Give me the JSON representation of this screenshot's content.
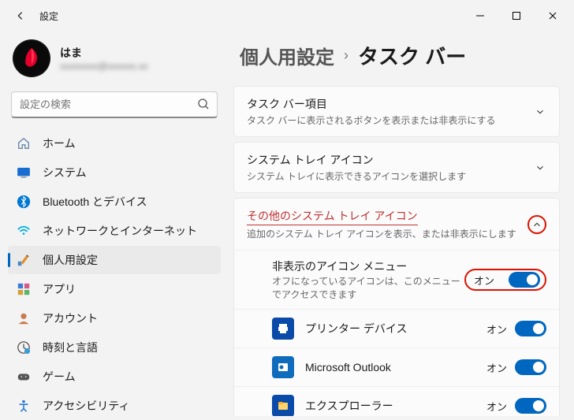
{
  "titlebar": {
    "title": "設定"
  },
  "user": {
    "name": "はま",
    "email": "xxxxxxxx@xxxxxx.xx"
  },
  "search": {
    "placeholder": "設定の検索"
  },
  "nav": {
    "items": [
      {
        "label": "ホーム"
      },
      {
        "label": "システム"
      },
      {
        "label": "Bluetooth とデバイス"
      },
      {
        "label": "ネットワークとインターネット"
      },
      {
        "label": "個人用設定"
      },
      {
        "label": "アプリ"
      },
      {
        "label": "アカウント"
      },
      {
        "label": "時刻と言語"
      },
      {
        "label": "ゲーム"
      },
      {
        "label": "アクセシビリティ"
      }
    ]
  },
  "breadcrumb": {
    "parent": "個人用設定",
    "sep": "›",
    "current": "タスク バー"
  },
  "sections": {
    "items": {
      "title": "タスク バー項目",
      "desc": "タスク バーに表示されるボタンを表示または非表示にする"
    },
    "tray": {
      "title": "システム トレイ アイコン",
      "desc": "システム トレイに表示できるアイコンを選択します"
    },
    "other": {
      "title": "その他のシステム トレイ アイコン",
      "desc": "追加のシステム トレイ アイコンを表示、または非表示にします"
    }
  },
  "rows": {
    "hiddenMenu": {
      "title": "非表示のアイコン メニュー",
      "desc": "オフになっているアイコンは、このメニューでアクセスできます",
      "state": "オン"
    },
    "printer": {
      "title": "プリンター デバイス",
      "state": "オン"
    },
    "outlook": {
      "title": "Microsoft Outlook",
      "state": "オン"
    },
    "explorer": {
      "title": "エクスプローラー",
      "state": "オン"
    }
  }
}
